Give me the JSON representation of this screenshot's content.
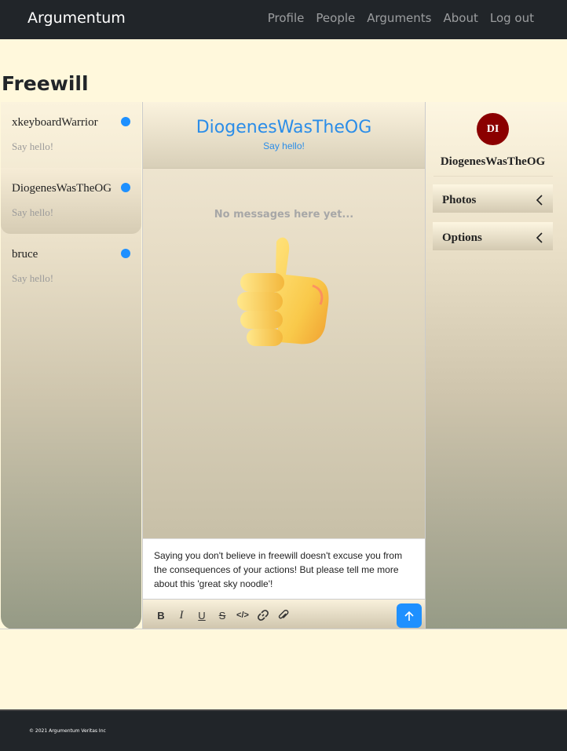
{
  "navbar": {
    "brand": "Argumentum",
    "links": [
      "Profile",
      "People",
      "Arguments",
      "About",
      "Log out"
    ]
  },
  "page": {
    "title": "Freewill"
  },
  "conversations": [
    {
      "name": "xkeyboardWarrior",
      "preview": "Say hello!",
      "unread": true
    },
    {
      "name": "DiogenesWasTheOG",
      "preview": "Say hello!",
      "unread": true,
      "active": true
    },
    {
      "name": "bruce",
      "preview": "Say hello!",
      "unread": true
    }
  ],
  "chat": {
    "header_name": "DiogenesWasTheOG",
    "header_sub": "Say hello!",
    "empty_text": "No messages here yet...",
    "empty_icon": "thumbs-up-emoji",
    "draft": "Saying you don't believe in freewill doesn't excuse you from the consequences of your actions! But please tell me more about this 'great sky noodle'!",
    "toolbar": [
      "bold",
      "italic",
      "underline",
      "strikethrough",
      "code",
      "link",
      "attachment"
    ],
    "send_icon": "arrow-up-icon"
  },
  "profile": {
    "initials": "DI",
    "name": "DiogenesWasTheOG",
    "sections": [
      "Photos",
      "Options"
    ]
  },
  "colors": {
    "accent": "#1e90ff",
    "avatar": "#8b0000",
    "navbar": "#212529",
    "background": "#fff8dc"
  },
  "footer": {
    "text": "© 2021 Argumentum Veritas Inc"
  }
}
